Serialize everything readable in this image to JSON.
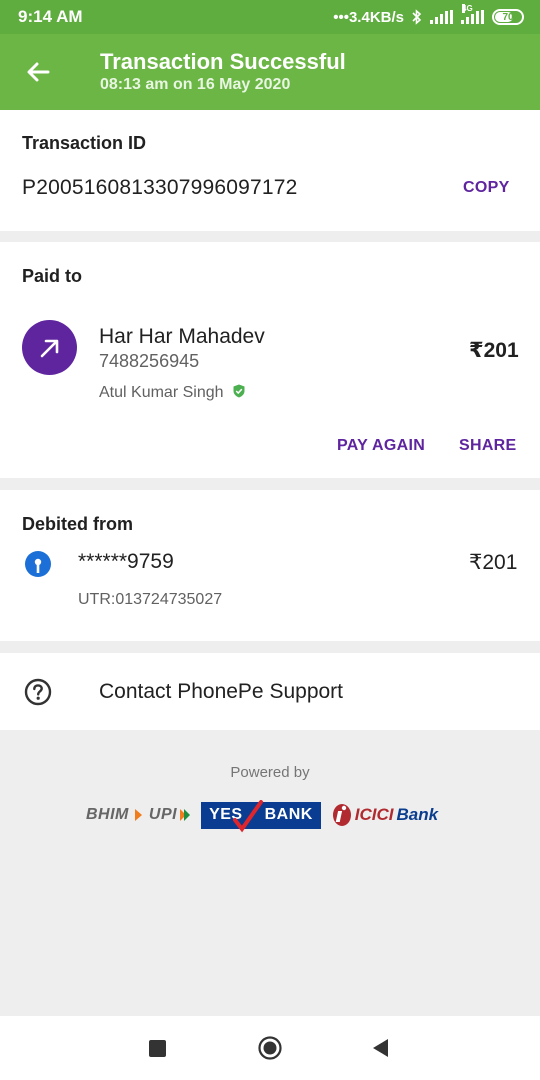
{
  "status_bar": {
    "time": "9:14 AM",
    "speed": "3.4KB/s",
    "network_label": "4G",
    "battery": "70"
  },
  "header": {
    "title": "Transaction Successful",
    "subtitle": "08:13 am on 16 May 2020"
  },
  "transaction": {
    "label": "Transaction ID",
    "id": "P2005160813307996097172",
    "copy_label": "COPY"
  },
  "paid_to": {
    "label": "Paid to",
    "name": "Har Har Mahadev",
    "phone": "7488256945",
    "verified_name": "Atul Kumar Singh",
    "amount": "₹201",
    "pay_again_label": "PAY AGAIN",
    "share_label": "SHARE"
  },
  "debited_from": {
    "label": "Debited from",
    "account": "******9759",
    "amount": "₹201",
    "utr": "UTR:013724735027"
  },
  "support": {
    "label": "Contact PhonePe Support"
  },
  "footer": {
    "powered_by": "Powered by",
    "logo_bhim": "BHIM",
    "logo_upi": "UPI",
    "logo_yes_1": "YES",
    "logo_yes_2": "BANK",
    "logo_icici_1": "ICICI",
    "logo_icici_2": "Bank"
  },
  "colors": {
    "header_green": "#6bb645",
    "status_green": "#5fac3f",
    "accent_purple": "#5f259f",
    "sbi_blue": "#1c6fd6",
    "verified_green": "#4caf50"
  },
  "icons": [
    "back-arrow",
    "payment-arrow",
    "verified-badge",
    "sbi-bank",
    "help-circle",
    "nav-recents",
    "nav-home",
    "nav-back"
  ]
}
